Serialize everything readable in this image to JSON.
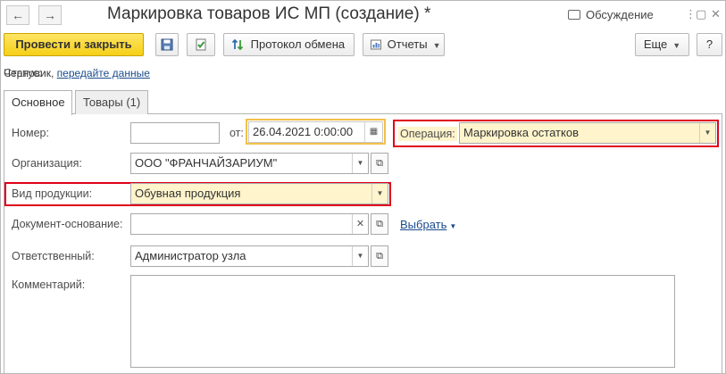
{
  "window": {
    "title": "Маркировка товаров ИС МП (создание) *",
    "discussion_label": "Обсуждение",
    "nav_back": "←",
    "nav_forward": "→",
    "menu_glyph": "⋮",
    "maximize_glyph": "▢",
    "close_glyph": "✕"
  },
  "toolbar": {
    "post_close_label": "Провести и закрыть",
    "exchange_log_label": "Протокол обмена",
    "reports_label": "Отчеты",
    "more_label": "Еще",
    "help_label": "?"
  },
  "status": {
    "label": "Статус:",
    "value": "Черновик,",
    "link": "передайте данные"
  },
  "tabs": [
    {
      "label": "Основное",
      "active": true
    },
    {
      "label": "Товары (1)",
      "active": false
    }
  ],
  "form": {
    "number_label": "Номер:",
    "number_value": "",
    "date_label": "от:",
    "date_value": "26.04.2021  0:00:00",
    "operation_label": "Операция:",
    "operation_value": "Маркировка остатков",
    "org_label": "Организация:",
    "org_value": "ООО \"ФРАНЧАЙЗАРИУМ\"",
    "product_kind_label": "Вид продукции:",
    "product_kind_value": "Обувная продукция",
    "base_doc_label": "Документ-основание:",
    "base_doc_value": "",
    "choose_link": "Выбрать",
    "responsible_label": "Ответственный:",
    "responsible_value": "Администратор узла",
    "comment_label": "Комментарий:",
    "comment_value": ""
  },
  "colors": {
    "primary_button": "#f5cf16",
    "highlight_red": "#e0001b",
    "date_focus": "#f2c14a",
    "field_yellow": "#fff4cc",
    "link": "#1a4b8c"
  }
}
